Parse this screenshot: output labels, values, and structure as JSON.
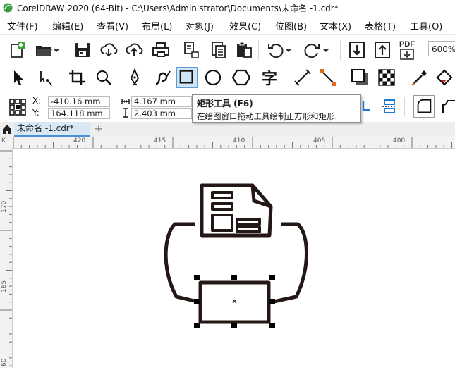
{
  "window": {
    "title": "CorelDRAW 2020 (64-Bit) - C:\\Users\\Administrator\\Documents\\未命名 -1.cdr*"
  },
  "menu": {
    "items": [
      {
        "label": "文件(F)"
      },
      {
        "label": "编辑(E)"
      },
      {
        "label": "查看(V)"
      },
      {
        "label": "布局(L)"
      },
      {
        "label": "对象(J)"
      },
      {
        "label": "效果(C)"
      },
      {
        "label": "位图(B)"
      },
      {
        "label": "文本(X)"
      },
      {
        "label": "表格(T)"
      },
      {
        "label": "工具(O)"
      }
    ]
  },
  "toolbar": {
    "zoom_value": "600%",
    "pdf_label": "PDF"
  },
  "property_bar": {
    "x_label": "X:",
    "x_value": "-410.16 mm",
    "y_label": "Y:",
    "y_value": "164.118 mm",
    "width_value": "4.167 mm",
    "height_value": "2.403 mm"
  },
  "tooltip": {
    "title": "矩形工具 (F6)",
    "description": "在绘图窗口拖动工具绘制正方形和矩形."
  },
  "tabs": {
    "document_tab": "未命名 -1.cdr*",
    "add_tab": "+"
  },
  "rulers": {
    "horizontal": [
      "420",
      "415",
      "410",
      "405",
      "400"
    ],
    "vertical": [
      "170",
      "165",
      "60"
    ],
    "corner": "K"
  },
  "colors": {
    "accent": "#4a90d9",
    "active_tool_bg": "#cfe4f7",
    "drawing_stroke": "#231815",
    "app_logo": "#4caf50"
  }
}
